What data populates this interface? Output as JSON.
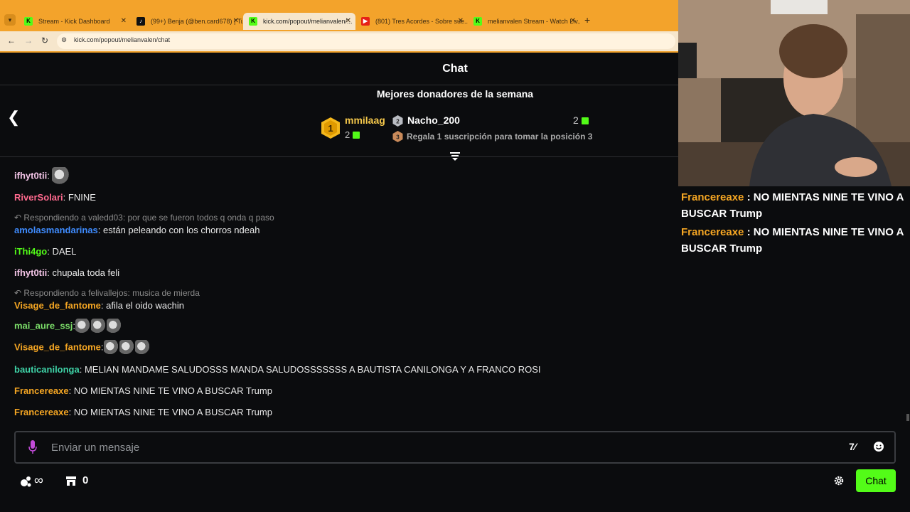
{
  "browser": {
    "tabs": [
      {
        "title": "Stream - Kick Dashboard",
        "favicon": "kick-icon",
        "active": false
      },
      {
        "title": "(99+) Benja (@ben.card678) | Ti...",
        "favicon": "tiktok-icon",
        "active": false
      },
      {
        "title": "kick.com/popout/melianvalen/...",
        "favicon": "kick-icon",
        "active": true
      },
      {
        "title": "(801) Tres Acordes - Sobre sue...",
        "favicon": "youtube-icon",
        "active": false
      },
      {
        "title": "melianvalen Stream - Watch Liv...",
        "favicon": "kick-icon",
        "active": false
      }
    ],
    "url": "kick.com/popout/melianvalen/chat",
    "accent": "#f3a32b"
  },
  "chat": {
    "title": "Chat",
    "donors_title": "Mejores donadores de la semana",
    "donors": [
      {
        "rank": "1",
        "name": "mmilaag",
        "count": "2"
      },
      {
        "rank": "2",
        "name": "Nacho_200",
        "count": "2"
      },
      {
        "rank": "3",
        "text": "Regala 1 suscripción para tomar la posición 3"
      }
    ],
    "messages": [
      {
        "user": "ifhyt0tii",
        "color": "#f3c4e6",
        "text": "",
        "emotes": 1
      },
      {
        "user": "RiverSolari",
        "color": "#ff6a8e",
        "text": "FNINE"
      },
      {
        "reply": "Respondiendo a valedd03: por que se fueron todos q onda q paso",
        "user": "amolasmandarinas",
        "color": "#3f8cff",
        "text": "están peleando con los chorros ndeah"
      },
      {
        "user": "iThi4go",
        "color": "#53fc18",
        "text": "DAEL"
      },
      {
        "user": "ifhyt0tii",
        "color": "#f3c4e6",
        "text": "chupala toda feli"
      },
      {
        "reply": "Respondiendo a felivallejos: musica de mierda",
        "user": "Visage_de_fantome",
        "color": "#f5a623",
        "text": "afila el oido wachin"
      },
      {
        "user": "mai_aure_ssj",
        "color": "#7ee26b",
        "text": "",
        "emotes": 3
      },
      {
        "user": "Visage_de_fantome",
        "color": "#f5a623",
        "text": "",
        "emotes": 3
      },
      {
        "user": "bauticanilonga",
        "color": "#3fd4a8",
        "text": "MELIAN MANDAME SALUDOSSS MANDA SALUDOSSSSSSS A BAUTISTA CANILONGA Y A FRANCO ROSI"
      },
      {
        "user": "Francereaxe",
        "color": "#f5a623",
        "text": "NO MIENTAS NINE TE VINO A BUSCAR Trump"
      },
      {
        "user": "Francereaxe",
        "color": "#f5a623",
        "text": "NO MIENTAS NINE TE VINO A BUSCAR Trump"
      }
    ],
    "input_placeholder": "Enviar un mensaje",
    "points_value": "∞",
    "store_value": "0",
    "chat_button": "Chat",
    "accent": "#53fc18"
  },
  "overlay": {
    "messages": [
      {
        "user": "Francereaxe",
        "text": ": NO MIENTAS NINE TE VINO A BUSCAR Trump"
      },
      {
        "user": "Francereaxe",
        "text": ": NO MIENTAS NINE TE VINO A BUSCAR Trump"
      }
    ]
  }
}
